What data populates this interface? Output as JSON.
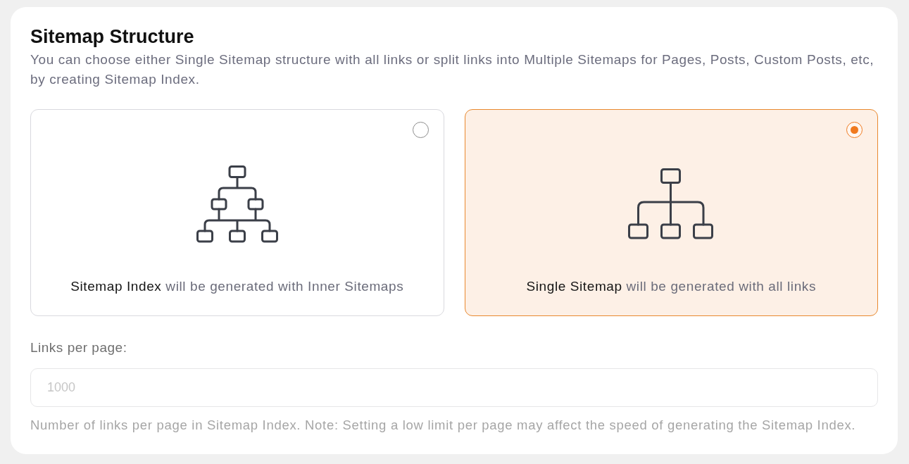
{
  "section": {
    "title": "Sitemap Structure",
    "description": "You can choose either Single Sitemap structure with all links or split links into Multiple Sitemaps for Pages, Posts, Custom Posts, etc, by creating Sitemap Index."
  },
  "options": [
    {
      "kind": "index",
      "caption": "**Sitemap Index** will be generated with Inner Sitemaps",
      "selected": false
    },
    {
      "kind": "single",
      "caption": "**Single Sitemap** will be generated with all links",
      "selected": true
    }
  ],
  "links_per_page": {
    "label": "Links per page:",
    "placeholder": "1000",
    "help": "Number of links per page in Sitemap Index. Note: Setting a low limit per page may affect the speed of generating the Sitemap Index."
  }
}
